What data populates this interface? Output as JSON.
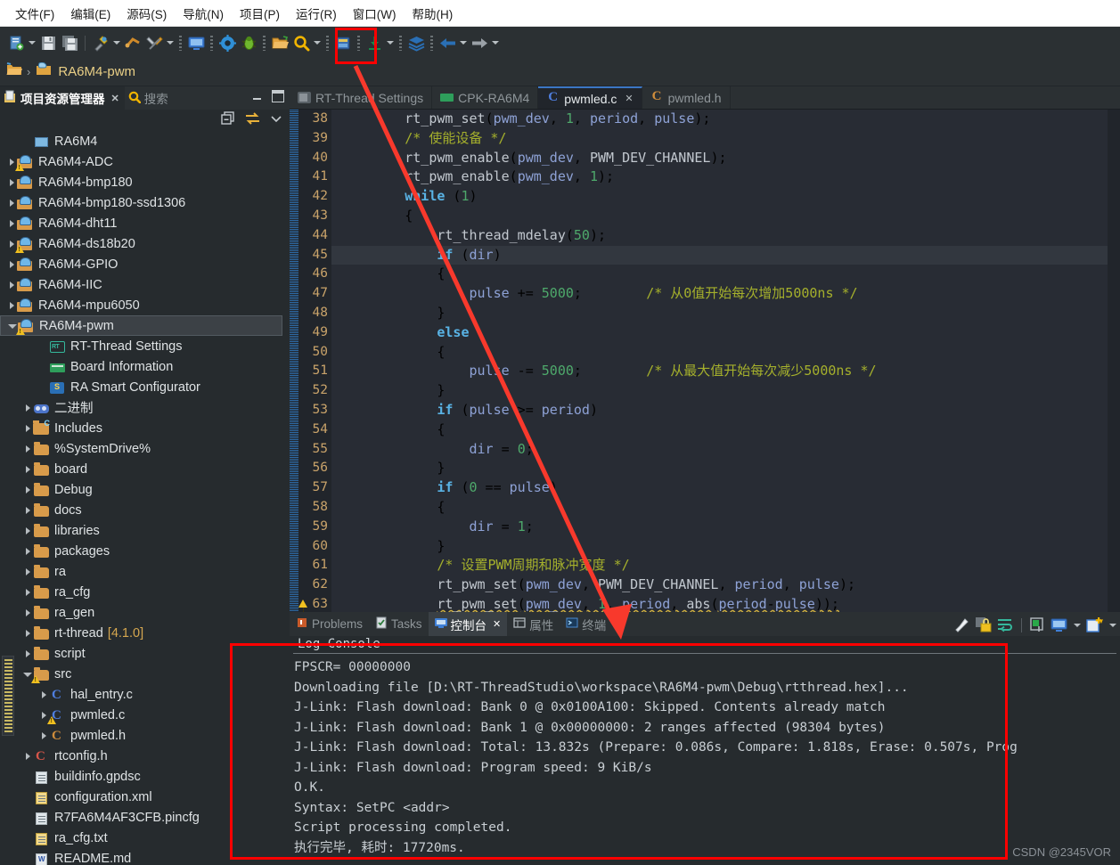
{
  "menu": {
    "items": [
      "文件(F)",
      "编辑(E)",
      "源码(S)",
      "导航(N)",
      "项目(P)",
      "运行(R)",
      "窗口(W)",
      "帮助(H)"
    ]
  },
  "toolbar": {
    "icons": [
      "new-file-icon",
      "save-icon",
      "save-all-icon",
      "build-icon",
      "debug-run-icon",
      "build-tools-icon",
      "console-icon",
      "settings-icon",
      "debug-bug-icon",
      "open-folder-icon",
      "search-icon",
      "package-icon",
      "download-icon",
      "layers-icon",
      "back-icon",
      "forward-icon"
    ],
    "highlighted": "download-icon"
  },
  "breadcrumb": {
    "project": "RA6M4-pwm"
  },
  "left_panel": {
    "tabs": [
      {
        "label": "项目资源管理器",
        "active": true,
        "icon": "project-explorer-icon",
        "closable": true
      },
      {
        "label": "搜索",
        "active": false,
        "icon": "search-icon",
        "closable": false
      }
    ],
    "window_buttons": [
      "minimize-icon",
      "maximize-icon"
    ],
    "view_menu": [
      "collapse-all-icon",
      "link-editor-icon",
      "view-menu-icon"
    ],
    "tree": [
      {
        "label": "RA6M4",
        "indent": 1,
        "arrow": "none",
        "icon": "box-icon",
        "warn": false
      },
      {
        "label": "RA6M4-ADC",
        "indent": 0,
        "arrow": "closed",
        "icon": "project-icon",
        "warn": true
      },
      {
        "label": "RA6M4-bmp180",
        "indent": 0,
        "arrow": "closed",
        "icon": "project-icon",
        "warn": false
      },
      {
        "label": "RA6M4-bmp180-ssd1306",
        "indent": 0,
        "arrow": "closed",
        "icon": "project-icon",
        "warn": false
      },
      {
        "label": "RA6M4-dht11",
        "indent": 0,
        "arrow": "closed",
        "icon": "project-icon",
        "warn": false
      },
      {
        "label": "RA6M4-ds18b20",
        "indent": 0,
        "arrow": "closed",
        "icon": "project-icon",
        "warn": true
      },
      {
        "label": "RA6M4-GPIO",
        "indent": 0,
        "arrow": "closed",
        "icon": "project-icon",
        "warn": false
      },
      {
        "label": "RA6M4-IIC",
        "indent": 0,
        "arrow": "closed",
        "icon": "project-icon",
        "warn": false
      },
      {
        "label": "RA6M4-mpu6050",
        "indent": 0,
        "arrow": "closed",
        "icon": "project-icon",
        "warn": false
      },
      {
        "label": "RA6M4-pwm",
        "indent": 0,
        "arrow": "open",
        "icon": "project-icon",
        "warn": true,
        "selected": true
      },
      {
        "label": "RT-Thread Settings",
        "indent": 2,
        "arrow": "none",
        "icon": "rt-thread-icon",
        "warn": false
      },
      {
        "label": "Board Information",
        "indent": 2,
        "arrow": "none",
        "icon": "board-icon",
        "warn": false
      },
      {
        "label": "RA Smart Configurator",
        "indent": 2,
        "arrow": "none",
        "icon": "ra-config-icon",
        "warn": false
      },
      {
        "label": "二进制",
        "indent": 1,
        "arrow": "closed",
        "icon": "binary-icon",
        "warn": false
      },
      {
        "label": "Includes",
        "indent": 1,
        "arrow": "closed",
        "icon": "includes-icon",
        "warn": false
      },
      {
        "label": "%SystemDrive%",
        "indent": 1,
        "arrow": "closed",
        "icon": "folder-icon",
        "warn": false
      },
      {
        "label": "board",
        "indent": 1,
        "arrow": "closed",
        "icon": "folder-icon",
        "warn": false
      },
      {
        "label": "Debug",
        "indent": 1,
        "arrow": "closed",
        "icon": "folder-icon",
        "warn": false
      },
      {
        "label": "docs",
        "indent": 1,
        "arrow": "closed",
        "icon": "folder-icon",
        "warn": false
      },
      {
        "label": "libraries",
        "indent": 1,
        "arrow": "closed",
        "icon": "folder-icon",
        "warn": false
      },
      {
        "label": "packages",
        "indent": 1,
        "arrow": "closed",
        "icon": "folder-icon",
        "warn": false
      },
      {
        "label": "ra",
        "indent": 1,
        "arrow": "closed",
        "icon": "folder-icon",
        "warn": false
      },
      {
        "label": "ra_cfg",
        "indent": 1,
        "arrow": "closed",
        "icon": "folder-icon",
        "warn": false
      },
      {
        "label": "ra_gen",
        "indent": 1,
        "arrow": "closed",
        "icon": "folder-icon",
        "warn": false
      },
      {
        "label": "rt-thread",
        "version": "[4.1.0]",
        "indent": 1,
        "arrow": "closed",
        "icon": "folder-icon",
        "warn": false
      },
      {
        "label": "script",
        "indent": 1,
        "arrow": "closed",
        "icon": "folder-icon",
        "warn": false
      },
      {
        "label": "src",
        "indent": 1,
        "arrow": "open",
        "icon": "folder-icon",
        "warn": true
      },
      {
        "label": "hal_entry.c",
        "indent": 2,
        "arrow": "closed",
        "icon": "c-file-icon",
        "warn": false
      },
      {
        "label": "pwmled.c",
        "indent": 2,
        "arrow": "closed",
        "icon": "c-file-icon",
        "warn": true
      },
      {
        "label": "pwmled.h",
        "indent": 2,
        "arrow": "closed",
        "icon": "h-file-icon",
        "warn": false
      },
      {
        "label": "rtconfig.h",
        "indent": 1,
        "arrow": "closed",
        "icon": "rtconfig-icon",
        "warn": false
      },
      {
        "label": "buildinfo.gpdsc",
        "indent": 1,
        "arrow": "none",
        "icon": "doc-icon",
        "warn": false
      },
      {
        "label": "configuration.xml",
        "indent": 1,
        "arrow": "none",
        "icon": "xml-icon",
        "warn": false
      },
      {
        "label": "R7FA6M4AF3CFB.pincfg",
        "indent": 1,
        "arrow": "none",
        "icon": "doc-icon",
        "warn": false
      },
      {
        "label": "ra_cfg.txt",
        "indent": 1,
        "arrow": "none",
        "icon": "xml-icon",
        "warn": false
      },
      {
        "label": "README.md",
        "indent": 1,
        "arrow": "none",
        "icon": "md-icon",
        "warn": false
      }
    ]
  },
  "editor": {
    "tabs": [
      {
        "label": "RT-Thread Settings",
        "active": false,
        "icon": "settings-tab-icon",
        "closable": false
      },
      {
        "label": "CPK-RA6M4",
        "active": false,
        "icon": "board-tab-icon",
        "closable": false
      },
      {
        "label": "pwmled.c",
        "active": true,
        "icon": "c-file-icon",
        "closable": true
      },
      {
        "label": "pwmled.h",
        "active": false,
        "icon": "h-file-icon",
        "closable": false
      }
    ],
    "current_line": 45,
    "lines": [
      {
        "n": 38,
        "html": "        <span class='fn'>rt_pwm_set</span>(<span class='var'>pwm_dev</span>, <span class='num'>1</span>, <span class='var'>period</span>, <span class='var'>pulse</span>);"
      },
      {
        "n": 39,
        "html": "        <span class='cmt'>/* 使能设备 */</span>"
      },
      {
        "n": 40,
        "html": "        <span class='fn'>rt_pwm_enable</span>(<span class='var'>pwm_dev</span>, <span class='mac'>PWM_DEV_CHANNEL</span>);"
      },
      {
        "n": 41,
        "html": "        <span class='fn'>rt_pwm_enable</span>(<span class='var'>pwm_dev</span>, <span class='num'>1</span>);"
      },
      {
        "n": 42,
        "html": "        <span class='kw'>while</span> (<span class='num'>1</span>)"
      },
      {
        "n": 43,
        "html": "        {"
      },
      {
        "n": 44,
        "html": "            <span class='fn'>rt_thread_mdelay</span>(<span class='num'>50</span>);"
      },
      {
        "n": 45,
        "html": "            <span class='kw'>if</span> (<span class='var'>dir</span>)"
      },
      {
        "n": 46,
        "html": "            {"
      },
      {
        "n": 47,
        "html": "                <span class='var'>pulse</span> += <span class='num'>5000</span>;        <span class='cmt'>/* 从0值开始每次增加5000ns */</span>"
      },
      {
        "n": 48,
        "html": "            }"
      },
      {
        "n": 49,
        "html": "            <span class='kw'>else</span>"
      },
      {
        "n": 50,
        "html": "            {"
      },
      {
        "n": 51,
        "html": "                <span class='var'>pulse</span> -= <span class='num'>5000</span>;        <span class='cmt'>/* 从最大值开始每次减少5000ns */</span>"
      },
      {
        "n": 52,
        "html": "            }"
      },
      {
        "n": 53,
        "html": "            <span class='kw'>if</span> (<span class='var'>pulse</span> &gt;= <span class='var'>period</span>)"
      },
      {
        "n": 54,
        "html": "            {"
      },
      {
        "n": 55,
        "html": "                <span class='var'>dir</span> = <span class='num'>0</span>;"
      },
      {
        "n": 56,
        "html": "            }"
      },
      {
        "n": 57,
        "html": "            <span class='kw'>if</span> (<span class='num'>0</span> == <span class='var'>pulse</span>)"
      },
      {
        "n": 58,
        "html": "            {"
      },
      {
        "n": 59,
        "html": "                <span class='var'>dir</span> = <span class='num'>1</span>;"
      },
      {
        "n": 60,
        "html": "            }"
      },
      {
        "n": 61,
        "html": "            <span class='cmt'>/* 设置PWM周期和脉冲宽度 */</span>"
      },
      {
        "n": 62,
        "html": "            <span class='fn'>rt_pwm_set</span>(<span class='var'>pwm_dev</span>, <span class='mac'>PWM_DEV_CHANNEL</span>, <span class='var'>period</span>, <span class='var'>pulse</span>);"
      },
      {
        "n": 63,
        "html": "            <span class='err'><span class='fn'>rt_pwm_set</span>(<span class='var'>pwm_dev</span>, <span class='num'>1</span>, <span class='var'>period</span>, <span class='fn'>abs</span>(<span class='var'>period</span>-<span class='var'>pulse</span>));</span>",
        "warn": true
      }
    ]
  },
  "console": {
    "tabs": [
      {
        "label": "Problems",
        "active": false,
        "icon": "problems-icon",
        "closable": false
      },
      {
        "label": "Tasks",
        "active": false,
        "icon": "tasks-icon",
        "closable": false
      },
      {
        "label": "控制台",
        "active": true,
        "icon": "console-icon",
        "closable": true
      },
      {
        "label": "属性",
        "active": false,
        "icon": "properties-icon",
        "closable": false
      },
      {
        "label": "终端",
        "active": false,
        "icon": "terminal-icon",
        "closable": false
      }
    ],
    "tools": [
      "clear-console-icon",
      "lock-scroll-icon",
      "word-wrap-icon",
      "pin-console-icon",
      "display-selected-console-icon",
      "display-console-dropdown-icon",
      "open-console-icon",
      "open-console-dropdown-icon"
    ],
    "title": "Log Console",
    "log": [
      "FPSCR= 00000000",
      "Downloading file [D:\\RT-ThreadStudio\\workspace\\RA6M4-pwm\\Debug\\rtthread.hex]...",
      "J-Link: Flash download: Bank 0 @ 0x0100A100: Skipped. Contents already match",
      "J-Link: Flash download: Bank 1 @ 0x00000000: 2 ranges affected (98304 bytes)",
      "J-Link: Flash download: Total: 13.832s (Prepare: 0.086s, Compare: 1.818s, Erase: 0.507s, Prog",
      "J-Link: Flash download: Program speed: 9 KiB/s",
      "O.K.",
      "Syntax: SetPC <addr>",
      "Script processing completed.",
      "执行完毕, 耗时: 17720ms."
    ]
  },
  "annotations": {
    "watermark": "CSDN @2345VOR",
    "highlight_color": "#fe0000",
    "arrow_color": "#f8392c",
    "arrow_from": "download-toolbar-button",
    "arrow_to": "console-log-output"
  }
}
